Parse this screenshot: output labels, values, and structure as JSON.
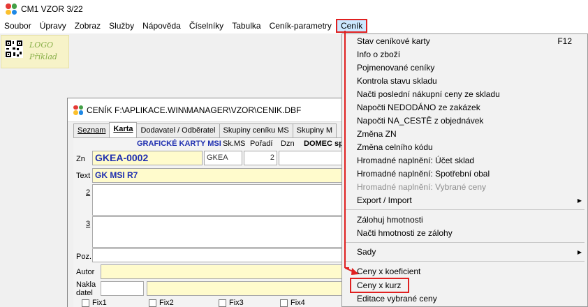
{
  "window": {
    "title": "CM1 VZOR 3/22"
  },
  "menubar": {
    "items": [
      "Soubor",
      "Úpravy",
      "Zobraz",
      "Služby",
      "Nápověda",
      "Číselníky",
      "Tabulka",
      "Ceník-parametry",
      "Ceník"
    ]
  },
  "logo": {
    "line1": "LOGO",
    "line2": "Příklad"
  },
  "inner": {
    "title": "CENÍK F:\\APLIKACE.WIN\\MANAGER\\VZOR\\CENIK.DBF",
    "tabs": [
      "Seznam",
      "Karta",
      "Dodavatel / Odběratel",
      "Skupiny ceníku MS",
      "Skupiny M"
    ],
    "header": {
      "group": "GRAFICKÉ KARTY MSI",
      "skms": "Sk.MS",
      "poradi": "Pořadí",
      "dzn": "Dzn",
      "domec": "DOMEC sp"
    },
    "labels": {
      "zn": "Zn",
      "text": "Text",
      "line2": "2",
      "line3": "3",
      "poz": "Poz.",
      "autor": "Autor",
      "nakla": "Nakla",
      "datel": "datel"
    },
    "fields": {
      "zn": "GKEA-0002",
      "skms": "GKEA",
      "poradi": "2",
      "text": "GK MSI R7"
    },
    "checkboxes": [
      "Fix1",
      "Fix2",
      "Fix3",
      "Fix4"
    ]
  },
  "dropdown": {
    "items": [
      {
        "label": "Stav ceníkové karty",
        "shortcut": "F12"
      },
      {
        "label": "Info o zboží"
      },
      {
        "label": "Pojmenované ceníky"
      },
      {
        "label": "Kontrola stavu skladu"
      },
      {
        "label": "Načti poslední nákupní ceny ze skladu"
      },
      {
        "label": "Napočti NEDODÁNO ze zakázek"
      },
      {
        "label": "Napočti NA_CESTĚ z objednávek"
      },
      {
        "label": "Změna ZN"
      },
      {
        "label": "Změna celního kódu"
      },
      {
        "label": "Hromadné naplnění: Účet sklad"
      },
      {
        "label": "Hromadné naplnění: Spotřební obal"
      },
      {
        "label": "Hromadné naplnění: Vybrané ceny",
        "disabled": true
      },
      {
        "label": "Export / Import",
        "submenu": true
      },
      {
        "label": "Zálohuj hmotnosti"
      },
      {
        "label": "Načti hmotnosti ze zálohy"
      },
      {
        "label": "Sady",
        "submenu": true
      },
      {
        "label": "Ceny x koeficient"
      },
      {
        "label": "Ceny x kurz"
      },
      {
        "label": "Editace vybrané ceny"
      }
    ]
  },
  "colors": {
    "highlight": "#e02020",
    "field_yellow": "#fffbcc",
    "text_blue": "#1f2fb0"
  }
}
